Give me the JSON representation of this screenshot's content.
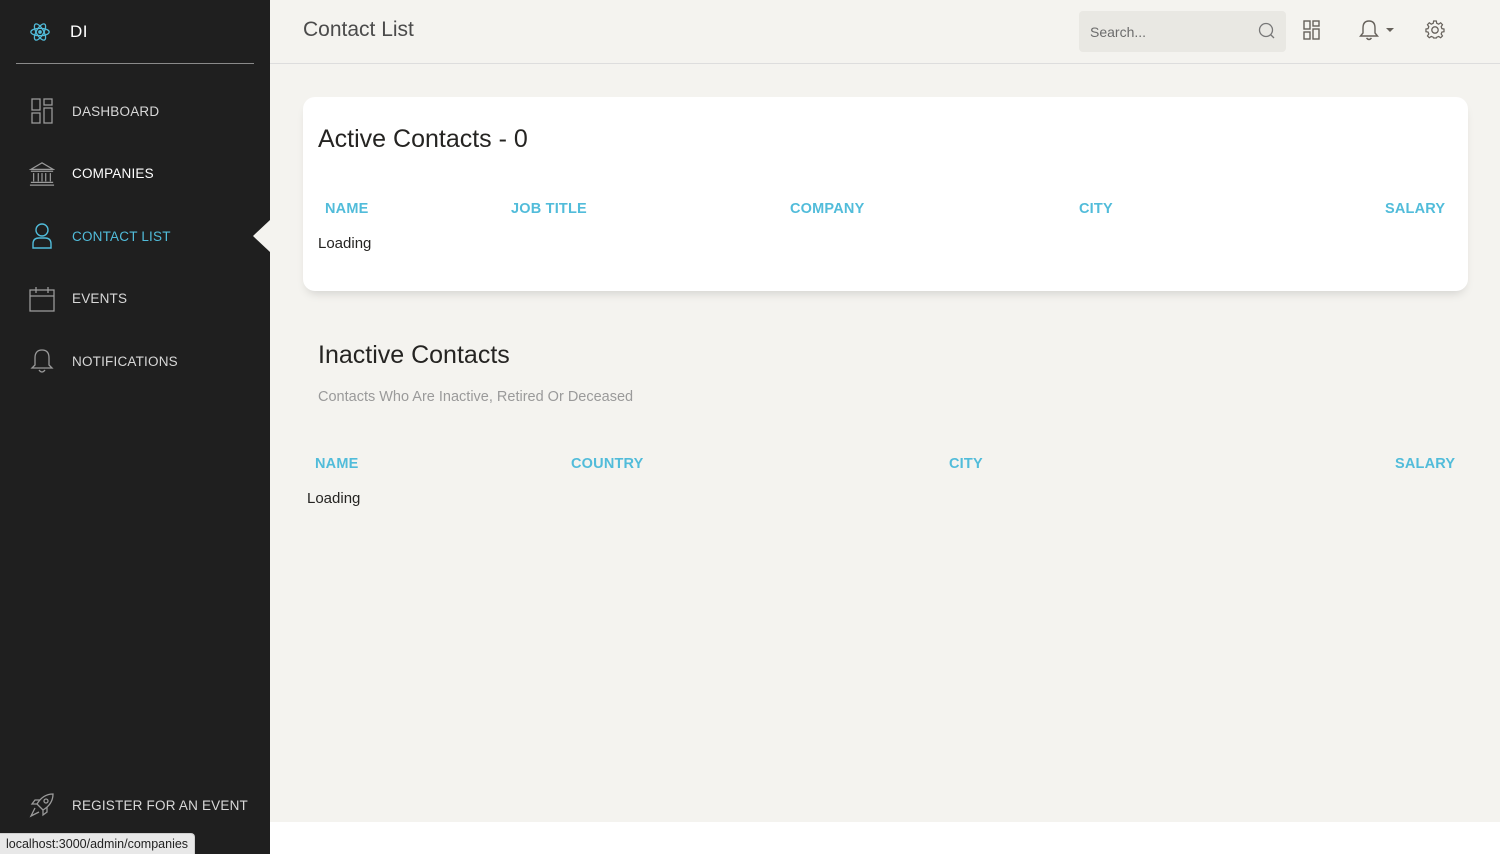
{
  "brand": {
    "name": "DI"
  },
  "sidebar": {
    "items": [
      {
        "label": "DASHBOARD",
        "icon": "dashboard-icon"
      },
      {
        "label": "COMPANIES",
        "icon": "bank-icon"
      },
      {
        "label": "CONTACT LIST",
        "icon": "user-icon"
      },
      {
        "label": "EVENTS",
        "icon": "calendar-icon"
      },
      {
        "label": "NOTIFICATIONS",
        "icon": "bell-icon"
      }
    ],
    "register_label": "REGISTER FOR AN EVENT"
  },
  "status_url": "localhost:3000/admin/companies",
  "header": {
    "title": "Contact List",
    "search_placeholder": "Search..."
  },
  "active": {
    "title": "Active Contacts - 0",
    "columns": [
      "NAME",
      "JOB TITLE",
      "COMPANY",
      "CITY",
      "SALARY"
    ],
    "loading": "Loading"
  },
  "inactive": {
    "title": "Inactive Contacts",
    "subtitle": "Contacts Who Are Inactive, Retired Or Deceased",
    "columns": [
      "NAME",
      "COUNTRY",
      "CITY",
      "SALARY"
    ],
    "loading": "Loading"
  },
  "colors": {
    "sidebar_bg": "#1f1f1f",
    "accent": "#51bcda",
    "content_bg": "#f4f3ef"
  }
}
